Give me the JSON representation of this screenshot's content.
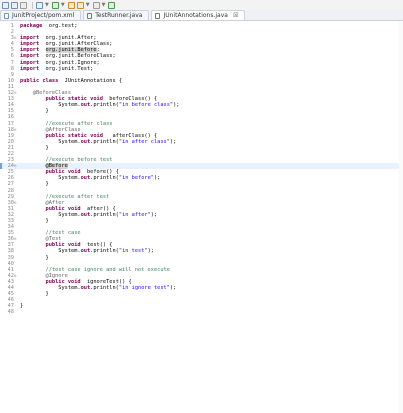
{
  "tabs": [
    {
      "label": "JunitProject/pom.xml",
      "icon": "xml-file-icon",
      "active": false
    },
    {
      "label": "TestRunner.java",
      "icon": "java-file-icon",
      "active": false
    },
    {
      "label": "JUnitAnnotations.java",
      "icon": "java-file-icon",
      "active": true,
      "close": "☒"
    }
  ],
  "editor": {
    "current_line": 24,
    "lines": [
      {
        "n": "1",
        "fold": "",
        "segs": [
          [
            "kw",
            "package"
          ],
          [
            "",
            "  org.test;"
          ]
        ]
      },
      {
        "n": "2",
        "fold": "",
        "segs": []
      },
      {
        "n": "3",
        "fold": "⊖",
        "segs": [
          [
            "kw",
            "import"
          ],
          [
            "",
            "  org.junit.After;"
          ]
        ]
      },
      {
        "n": "4",
        "fold": "",
        "segs": [
          [
            "kw",
            "import"
          ],
          [
            "",
            "  org.junit.AfterClass;"
          ]
        ]
      },
      {
        "n": "5",
        "fold": "",
        "segs": [
          [
            "kw",
            "import"
          ],
          [
            "",
            "  "
          ],
          [
            "hl",
            "org.junit.Before"
          ],
          [
            "",
            ";"
          ]
        ]
      },
      {
        "n": "6",
        "fold": "",
        "segs": [
          [
            "kw",
            "import"
          ],
          [
            "",
            "  org.junit.BeforeClass;"
          ]
        ]
      },
      {
        "n": "7",
        "fold": "",
        "segs": [
          [
            "kw",
            "import"
          ],
          [
            "",
            "  org.junit.Ignore;"
          ]
        ]
      },
      {
        "n": "8",
        "fold": "",
        "segs": [
          [
            "kw",
            "import"
          ],
          [
            "",
            "  org.junit.Test;"
          ]
        ]
      },
      {
        "n": "9",
        "fold": "",
        "segs": []
      },
      {
        "n": "10",
        "fold": "",
        "segs": [
          [
            "kw",
            "public class"
          ],
          [
            "",
            "  JUnitAnnotations {"
          ]
        ]
      },
      {
        "n": "11",
        "fold": "",
        "segs": []
      },
      {
        "n": "12",
        "fold": "⊖",
        "segs": [
          [
            "an",
            "    @BeforeClass"
          ]
        ]
      },
      {
        "n": "13",
        "fold": "",
        "segs": [
          [
            "",
            "        "
          ],
          [
            "kw",
            "public static void"
          ],
          [
            "",
            "  beforeClass() {"
          ]
        ]
      },
      {
        "n": "14",
        "fold": "",
        "segs": [
          [
            "",
            "            System."
          ],
          [
            "kw",
            "out"
          ],
          [
            "",
            ".println("
          ],
          [
            "str",
            "\"in before class\""
          ],
          [
            "",
            ");"
          ]
        ]
      },
      {
        "n": "15",
        "fold": "",
        "segs": [
          [
            "",
            "        }"
          ]
        ]
      },
      {
        "n": "16",
        "fold": "",
        "segs": []
      },
      {
        "n": "17",
        "fold": "",
        "segs": [
          [
            "cm",
            "        //execute after class"
          ]
        ]
      },
      {
        "n": "18",
        "fold": "⊖",
        "segs": [
          [
            "an",
            "        @AfterClass"
          ]
        ]
      },
      {
        "n": "19",
        "fold": "",
        "segs": [
          [
            "",
            "        "
          ],
          [
            "kw",
            "public static void"
          ],
          [
            "",
            "   afterClass() {"
          ]
        ]
      },
      {
        "n": "20",
        "fold": "",
        "segs": [
          [
            "",
            "            System."
          ],
          [
            "kw",
            "out"
          ],
          [
            "",
            ".println("
          ],
          [
            "str",
            "\"in after class\""
          ],
          [
            "",
            ");"
          ]
        ]
      },
      {
        "n": "21",
        "fold": "",
        "segs": [
          [
            "",
            "        }"
          ]
        ]
      },
      {
        "n": "22",
        "fold": "",
        "segs": []
      },
      {
        "n": "23",
        "fold": "",
        "segs": [
          [
            "cm",
            "        //execute before test"
          ]
        ]
      },
      {
        "n": "24",
        "fold": "⊖",
        "segs": [
          [
            "",
            "        "
          ],
          [
            "hl",
            "@Before"
          ]
        ]
      },
      {
        "n": "25",
        "fold": "",
        "segs": [
          [
            "",
            "        "
          ],
          [
            "kw",
            "public void"
          ],
          [
            "",
            "  before() {"
          ]
        ]
      },
      {
        "n": "26",
        "fold": "",
        "segs": [
          [
            "",
            "            System."
          ],
          [
            "kw",
            "out"
          ],
          [
            "",
            ".println("
          ],
          [
            "str",
            "\"in before\""
          ],
          [
            "",
            ");"
          ]
        ]
      },
      {
        "n": "27",
        "fold": "",
        "segs": [
          [
            "",
            "        }"
          ]
        ]
      },
      {
        "n": "28",
        "fold": "",
        "segs": []
      },
      {
        "n": "29",
        "fold": "",
        "segs": [
          [
            "cm",
            "        //execute after test"
          ]
        ]
      },
      {
        "n": "30",
        "fold": "⊖",
        "segs": [
          [
            "an",
            "        @After"
          ]
        ]
      },
      {
        "n": "31",
        "fold": "",
        "segs": [
          [
            "",
            "        "
          ],
          [
            "kw",
            "public void"
          ],
          [
            "",
            "  after() {"
          ]
        ]
      },
      {
        "n": "32",
        "fold": "",
        "segs": [
          [
            "",
            "            System."
          ],
          [
            "kw",
            "out"
          ],
          [
            "",
            ".println("
          ],
          [
            "str",
            "\"in after\""
          ],
          [
            "",
            ");"
          ]
        ]
      },
      {
        "n": "33",
        "fold": "",
        "segs": [
          [
            "",
            "        }"
          ]
        ]
      },
      {
        "n": "34",
        "fold": "",
        "segs": []
      },
      {
        "n": "35",
        "fold": "",
        "segs": [
          [
            "cm",
            "        //test case"
          ]
        ]
      },
      {
        "n": "36",
        "fold": "⊖",
        "segs": [
          [
            "an",
            "        @Test"
          ]
        ]
      },
      {
        "n": "37",
        "fold": "",
        "segs": [
          [
            "",
            "        "
          ],
          [
            "kw",
            "public void"
          ],
          [
            "",
            "  test() {"
          ]
        ]
      },
      {
        "n": "38",
        "fold": "",
        "segs": [
          [
            "",
            "            System."
          ],
          [
            "kw",
            "out"
          ],
          [
            "",
            ".println("
          ],
          [
            "str",
            "\"in test\""
          ],
          [
            "",
            ");"
          ]
        ]
      },
      {
        "n": "39",
        "fold": "",
        "segs": [
          [
            "",
            "        }"
          ]
        ]
      },
      {
        "n": "40",
        "fold": "",
        "segs": []
      },
      {
        "n": "41",
        "fold": "",
        "segs": [
          [
            "cm",
            "        //test case ignore and will not execute"
          ]
        ]
      },
      {
        "n": "42",
        "fold": "⊖",
        "segs": [
          [
            "an",
            "        @Ignore"
          ]
        ]
      },
      {
        "n": "43",
        "fold": "",
        "segs": [
          [
            "",
            "        "
          ],
          [
            "kw",
            "public void"
          ],
          [
            "",
            "  ignoreTest() {"
          ]
        ]
      },
      {
        "n": "44",
        "fold": "",
        "segs": [
          [
            "",
            "            System."
          ],
          [
            "kw",
            "out"
          ],
          [
            "",
            ".println("
          ],
          [
            "str",
            "\"in ignore test\""
          ],
          [
            "",
            ");"
          ]
        ]
      },
      {
        "n": "45",
        "fold": "",
        "segs": [
          [
            "",
            "        }"
          ]
        ]
      },
      {
        "n": "46",
        "fold": "",
        "segs": []
      },
      {
        "n": "47",
        "fold": "",
        "segs": [
          [
            "",
            "}"
          ]
        ]
      },
      {
        "n": "48",
        "fold": "",
        "segs": []
      }
    ]
  }
}
